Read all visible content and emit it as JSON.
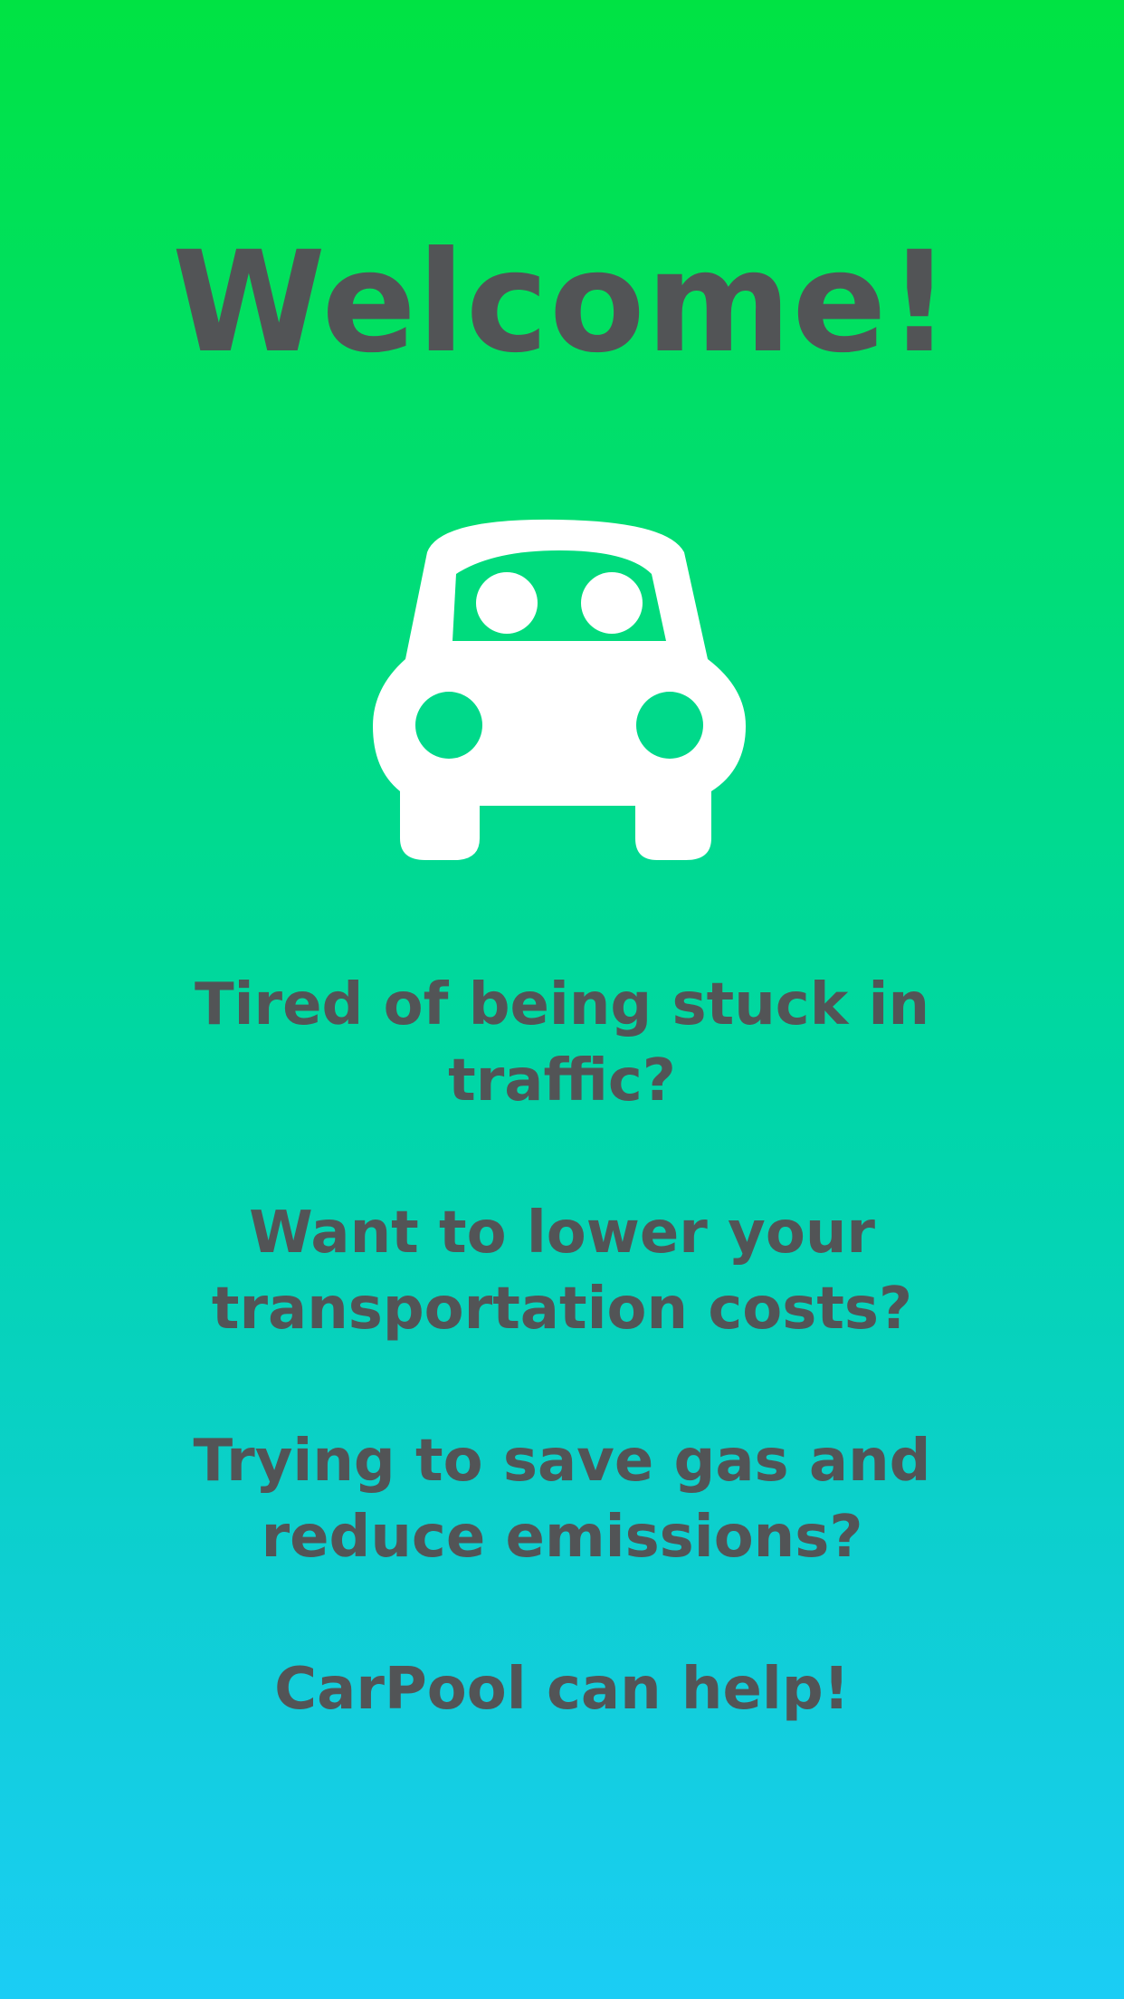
{
  "welcome": {
    "title": "Welcome!"
  },
  "hero": {
    "icon": "car-icon"
  },
  "messages": [
    "Tired of being stuck in traffic?",
    "Want to lower your transportation costs?",
    "Trying to save gas and reduce emissions?",
    "CarPool can help!"
  ],
  "colors": {
    "gradient_top": "#00e343",
    "gradient_bottom": "#1bcdf5",
    "text": "#525456",
    "icon": "#ffffff"
  }
}
